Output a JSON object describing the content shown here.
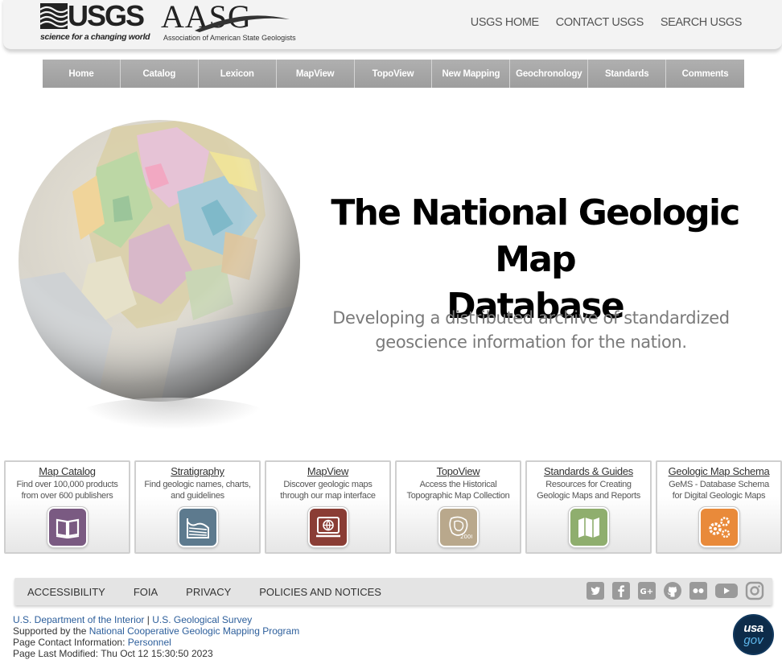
{
  "header": {
    "usgs_wordmark": "USGS",
    "usgs_tagline": "science for a changing world",
    "aasg_wordmark": "AASG",
    "aasg_tagline": "Association of American State Geologists",
    "links": [
      "USGS HOME",
      "CONTACT USGS",
      "SEARCH USGS"
    ]
  },
  "nav": [
    "Home",
    "Catalog",
    "Lexicon",
    "MapView",
    "TopoView",
    "New Mapping",
    "Geochronology",
    "Standards",
    "Comments"
  ],
  "hero": {
    "title_line1": "The National Geologic Map",
    "title_line2": "Database",
    "subtitle_line1": "Developing a distributed archive of standardized",
    "subtitle_line2": "geoscience information for the nation."
  },
  "cards": [
    {
      "title": "Map Catalog",
      "desc1": "Find over 100,000 products",
      "desc2": "from over 600 publishers",
      "icon": "book-icon",
      "color": "#7a5a82"
    },
    {
      "title": "Stratigraphy",
      "desc1": "Find geologic names, charts,",
      "desc2": "and guidelines",
      "icon": "strata-icon",
      "color": "#5d7a8e"
    },
    {
      "title": "MapView",
      "desc1": "Discover geologic maps",
      "desc2": "through our map interface",
      "icon": "monitor-globe-icon",
      "color": "#8a3d35"
    },
    {
      "title": "TopoView",
      "desc1": "Access the Historical",
      "desc2": "Topographic Map Collection",
      "icon": "topo-2000-icon",
      "color": "#b9a88c"
    },
    {
      "title": "Standards & Guides",
      "desc1": "Resources for Creating",
      "desc2": "Geologic Maps and Reports",
      "icon": "folded-map-icon",
      "color": "#8fae6e"
    },
    {
      "title": "Geologic Map Schema",
      "desc1": "GeMS - Database Schema",
      "desc2": "for Digital Geologic Maps",
      "icon": "gears-icon",
      "color": "#e98a3a"
    }
  ],
  "footer": {
    "links": [
      "ACCESSIBILITY",
      "FOIA",
      "PRIVACY",
      "POLICIES AND NOTICES"
    ],
    "social_icons": [
      "twitter-icon",
      "facebook-icon",
      "google-plus-icon",
      "github-icon",
      "flickr-icon",
      "youtube-icon",
      "instagram-icon"
    ],
    "social_color": "#9a9a9a",
    "doi_link": "U.S. Department of the Interior",
    "separator": "|",
    "usgs_link": "U.S. Geological Survey",
    "supported_prefix": "Supported by the",
    "ncgmp_link": "National Cooperative Geologic Mapping Program",
    "contact_prefix": "Page Contact Information:",
    "contact_link": "Personnel",
    "modified_prefix": "Page Last Modified:",
    "modified_value": "Thu Oct 12 15:30:50 2023",
    "usagov_1": "usa",
    "usagov_2": "gov"
  }
}
